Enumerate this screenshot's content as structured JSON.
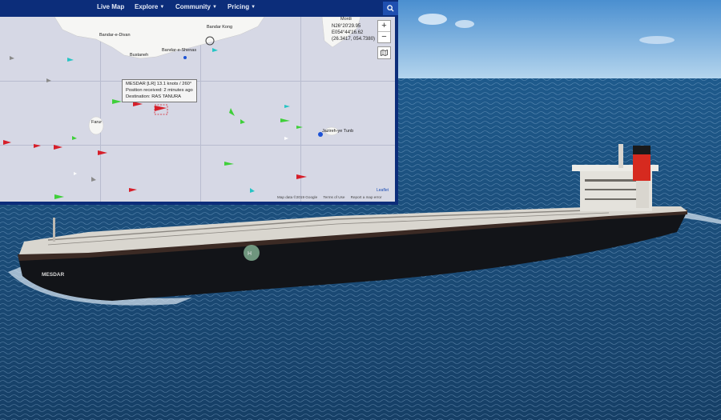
{
  "navbar": {
    "items": [
      {
        "label": "Live Map"
      },
      {
        "label": "Explore"
      },
      {
        "label": "Community"
      },
      {
        "label": "Pricing"
      }
    ]
  },
  "map": {
    "places": {
      "bandar_e_divan": "Bandar-e-Divan",
      "bandar_kong": "Bandar Kong",
      "mordi": "Mordi",
      "bustaneh": "Bustaneh",
      "bandar_e_shenas": "Bandar-e-Shenas",
      "farur": "Farur",
      "qeshm_tunb": "Jazireh-ye Tunb"
    },
    "coords": {
      "line1": "N26°20'29.95",
      "line2": "E054°44'16.62",
      "line3": "(26.3417, 054.7380)"
    },
    "tooltip": {
      "line1": "MESDAR [LR] 13.1 knots / 260°",
      "line2": "Position received: 2 minutes ago",
      "line3": "Destination: RAS TANURA"
    },
    "zoom_in": "+",
    "zoom_out": "−",
    "attribution": {
      "map_data": "Map data ©2019 Google",
      "terms": "Terms of Use",
      "report": "Report a map error",
      "leaflet": "Leaflet"
    }
  },
  "ship_hull_name": "MESDAR",
  "colors": {
    "nav_bg": "#0c2d7a",
    "tanker_red": "#d61f2a",
    "cargo_green": "#3fcf3a",
    "passenger_blue": "#1c52d6",
    "tug_cyan": "#27c4c4",
    "sea": "#1d4f7d",
    "hull": "#121418"
  }
}
